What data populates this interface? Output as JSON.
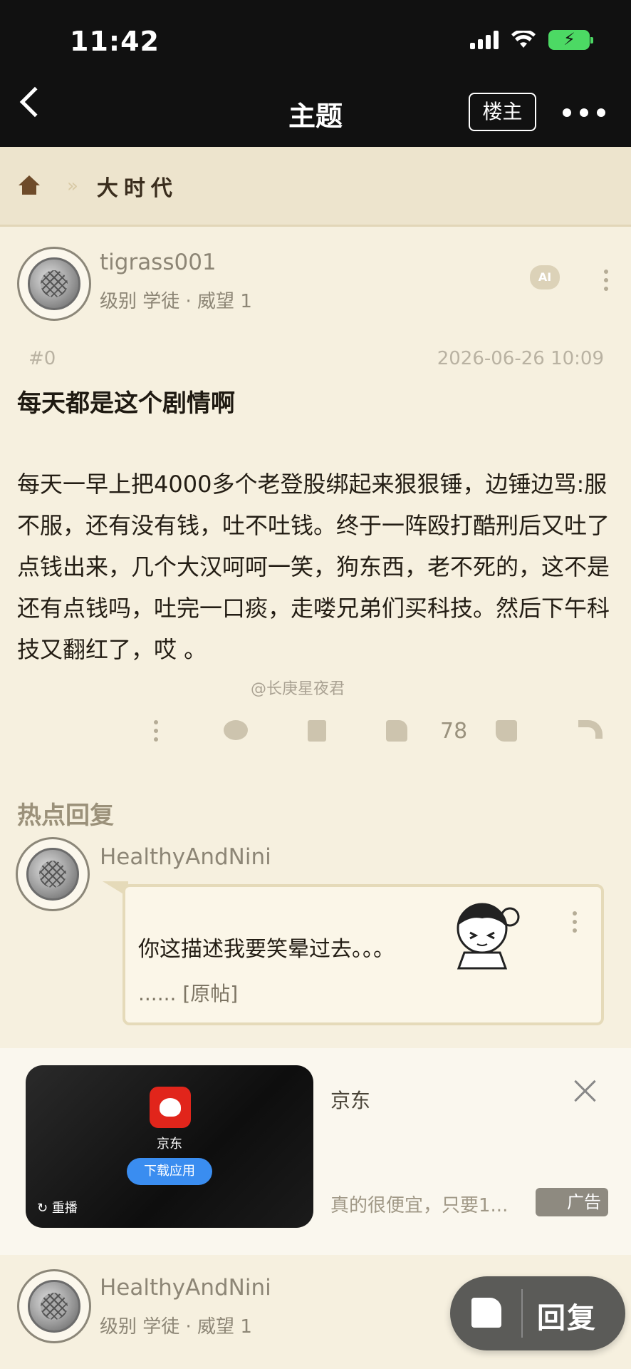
{
  "status_bar": {
    "time": "11:42"
  },
  "nav": {
    "title": "主题",
    "louzhu_label": "楼主"
  },
  "breadcrumb": {
    "separator": "»",
    "forum": "大时代"
  },
  "post": {
    "author": "tigrass001",
    "author_info": "级别 学徒 · 威望 1",
    "ai_label": "AI",
    "floor": "#0",
    "date": "2026-06-26 10:09",
    "title": "每天都是这个剧情啊",
    "body": "每天一早上把4000多个老登股绑起来狠狠锤，边锤边骂:服不服，还有没有钱，吐不吐钱。终于一阵殴打酷刑后又吐了点钱出来，几个大汉呵呵一笑，狗东西，老不死的，这不是还有点钱吗，吐完一口痰，走喽兄弟们买科技。然后下午科技又翻红了，哎 。",
    "watermark": "@长庚星夜君",
    "like_count": "78"
  },
  "hot_replies": {
    "heading": "热点回复",
    "items": [
      {
        "author": "HealthyAndNini",
        "text": "你这描述我要笑晕过去。。。",
        "ellipsis": "......",
        "original_link": "[原帖]"
      }
    ]
  },
  "ad": {
    "app_name": "京东",
    "download_label": "下载应用",
    "replay_label": "重播",
    "brand": "京东",
    "description": "真的很便宜，只要1...",
    "ad_label": "广告"
  },
  "next_post": {
    "author": "HealthyAndNini",
    "author_info": "级别 学徒 · 威望 1"
  },
  "float_button": {
    "reply_label": "回复"
  }
}
